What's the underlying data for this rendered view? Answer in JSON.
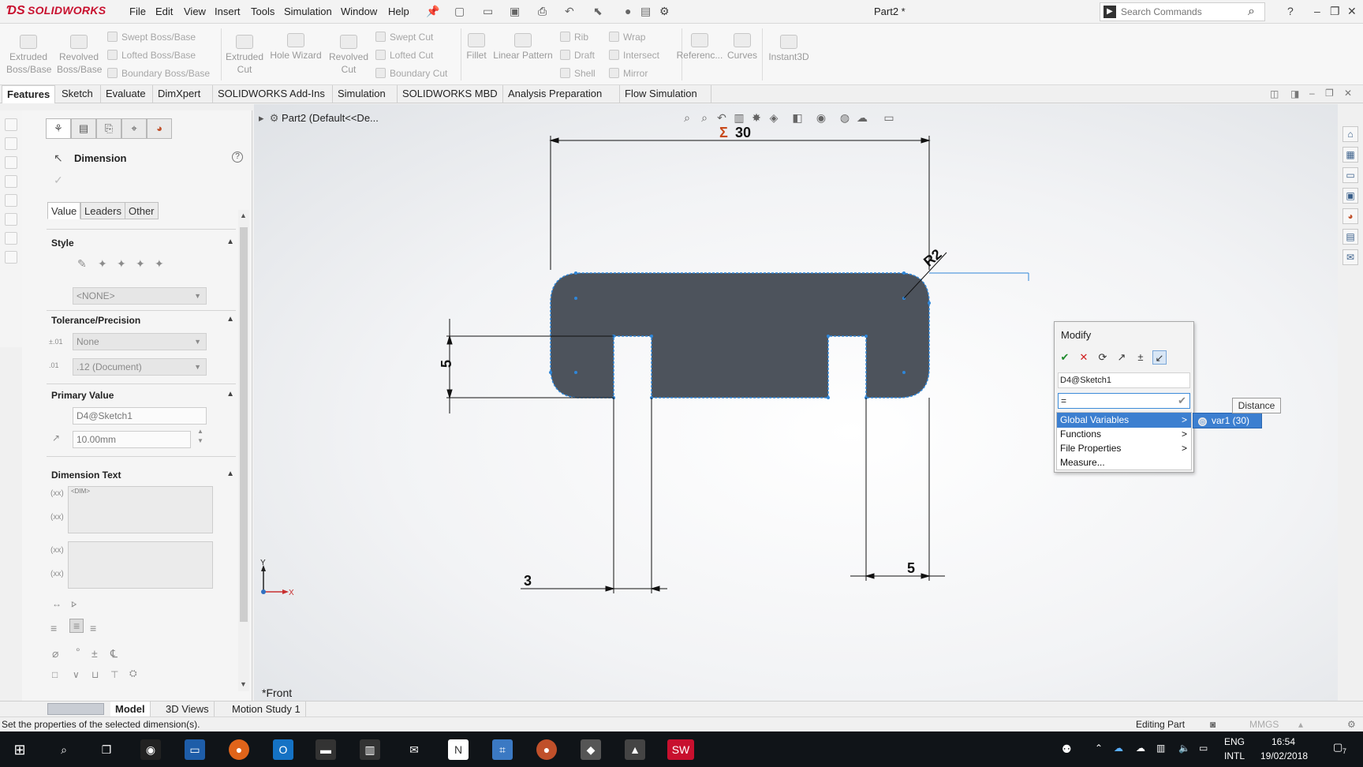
{
  "app": {
    "logo_text": "SOLIDWORKS",
    "doc_title": "Part2 *",
    "menu": [
      "File",
      "Edit",
      "View",
      "Insert",
      "Tools",
      "Simulation",
      "Window",
      "Help"
    ],
    "search_placeholder": "Search Commands",
    "help_label": "?"
  },
  "ribbon": {
    "big": [
      {
        "label1": "Extruded",
        "label2": "Boss/Base"
      },
      {
        "label1": "Revolved",
        "label2": "Boss/Base"
      },
      {
        "label1": "Extruded",
        "label2": "Cut"
      },
      {
        "label1": "Hole Wizard",
        "label2": ""
      },
      {
        "label1": "Revolved",
        "label2": "Cut"
      },
      {
        "label1": "Fillet",
        "label2": ""
      },
      {
        "label1": "Linear Pattern",
        "label2": ""
      },
      {
        "label1": "Referenc...",
        "label2": ""
      },
      {
        "label1": "Curves",
        "label2": ""
      },
      {
        "label1": "Instant3D",
        "label2": ""
      }
    ],
    "small": [
      "Swept Boss/Base",
      "Lofted Boss/Base",
      "Boundary Boss/Base",
      "Swept Cut",
      "Lofted Cut",
      "Boundary Cut",
      "Rib",
      "Draft",
      "Shell",
      "Wrap",
      "Intersect",
      "Mirror"
    ]
  },
  "tabs": [
    "Features",
    "Sketch",
    "Evaluate",
    "DimXpert",
    "SOLIDWORKS Add-Ins",
    "Simulation",
    "SOLIDWORKS MBD",
    "Analysis Preparation",
    "Flow Simulation"
  ],
  "property_manager": {
    "title": "Dimension",
    "subtabs": [
      "Value",
      "Leaders",
      "Other"
    ],
    "style": {
      "header": "Style",
      "select": "<NONE>"
    },
    "tolerance": {
      "header": "Tolerance/Precision",
      "type": "None",
      "precision": ".12 (Document)"
    },
    "primary": {
      "header": "Primary Value",
      "name": "D4@Sketch1",
      "value": "10.00mm"
    },
    "dim_text": {
      "header": "Dimension Text",
      "placeholder": "<DIM>"
    }
  },
  "graphics": {
    "tree_label": "Part2  (Default<<De...",
    "view_label": "*Front",
    "dims": {
      "width": "30",
      "radius": "R2",
      "height": "5",
      "slot1": "3",
      "slot2": "5"
    },
    "sigma": "Σ",
    "axis_x": "X",
    "axis_y": "Y"
  },
  "modify": {
    "title": "Modify",
    "dim_name": "D4@Sketch1",
    "equation": "=",
    "menu": [
      "Global Variables",
      "Functions",
      "File Properties",
      "Measure..."
    ],
    "submenu_item": "var1 (30)",
    "tooltip": "Distance"
  },
  "bottom_tabs": [
    "Model",
    "3D Views",
    "Motion Study 1"
  ],
  "status": {
    "message": "Set the properties of the selected dimension(s).",
    "editing": "Editing Part",
    "units": "MMGS"
  },
  "taskbar": {
    "lang1": "ENG",
    "lang2": "INTL",
    "time": "16:54",
    "date": "19/02/2018",
    "notif": "7"
  }
}
